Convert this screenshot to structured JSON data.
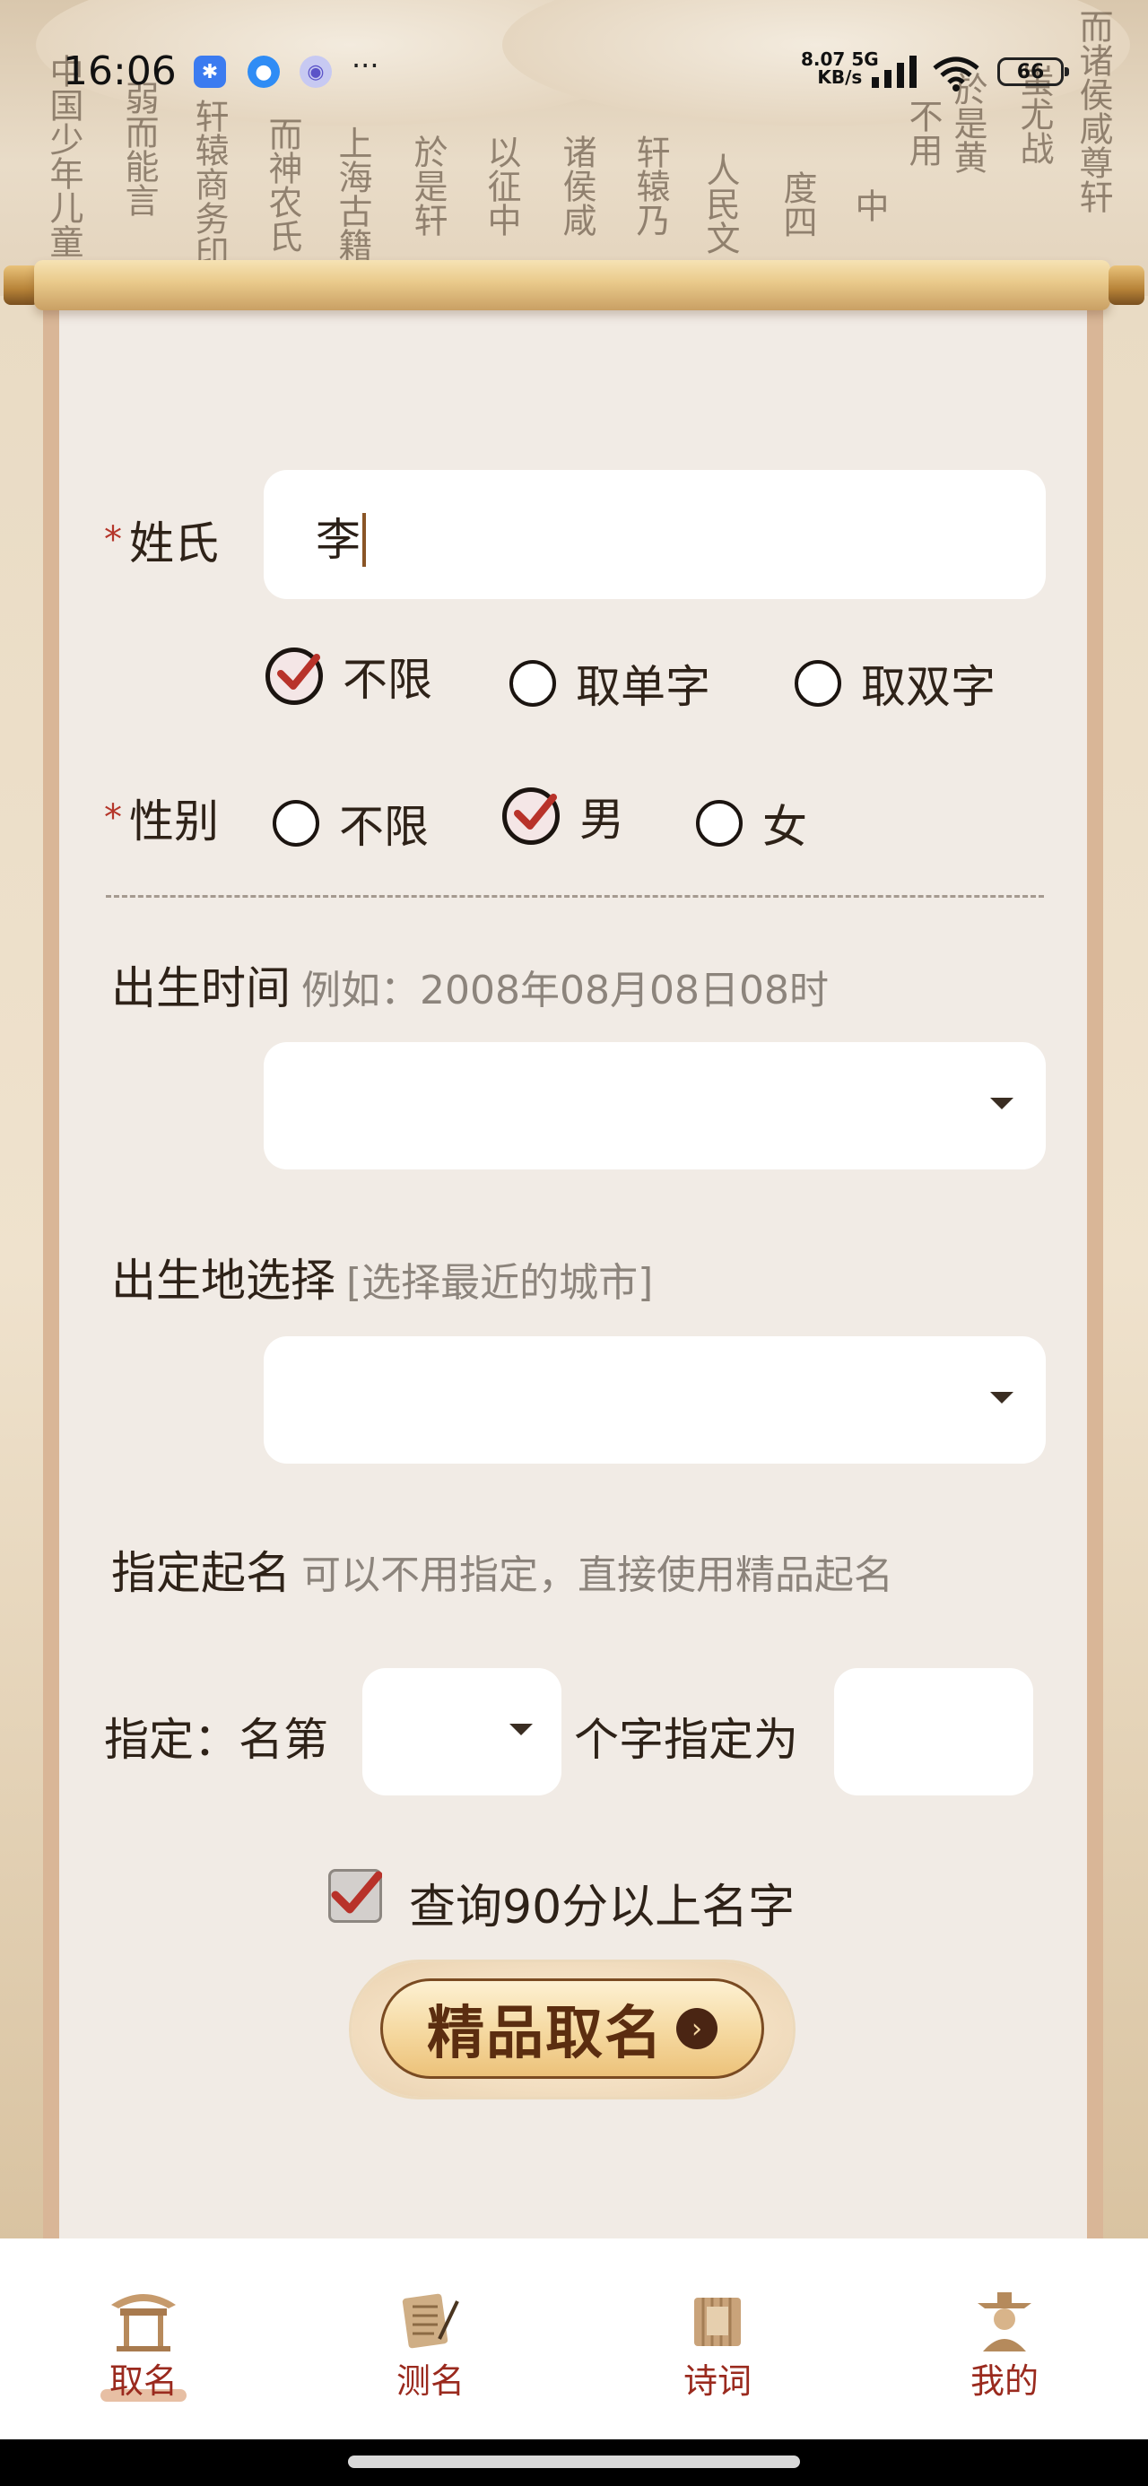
{
  "status_bar": {
    "time": "16:06",
    "network_speed": "8.07",
    "network_unit": "KB/s",
    "network_type": "5G",
    "battery": "66",
    "icons": [
      "app-notification-icon",
      "location-app-icon",
      "browser-app-icon",
      "more-dots-icon",
      "signal-icon",
      "wifi-icon",
      "battery-icon"
    ]
  },
  "form": {
    "surname": {
      "label": "姓氏",
      "required_mark": "*",
      "value": "李"
    },
    "char_count_options": [
      {
        "label": "不限",
        "checked": true
      },
      {
        "label": "取单字",
        "checked": false
      },
      {
        "label": "取双字",
        "checked": false
      }
    ],
    "gender": {
      "label": "性别",
      "required_mark": "*",
      "options": [
        {
          "label": "不限",
          "checked": false
        },
        {
          "label": "男",
          "checked": true
        },
        {
          "label": "女",
          "checked": false
        }
      ]
    },
    "birth_time": {
      "label": "出生时间",
      "hint": "例如：2008年08月08日08时",
      "value": ""
    },
    "birth_place": {
      "label": "出生地选择",
      "hint": "[选择最近的城市]",
      "value": ""
    },
    "specify": {
      "label": "指定起名",
      "hint": "可以不用指定，直接使用精品起名",
      "row_prefix": "指定：名第",
      "row_middle": "个字指定为",
      "position_value": "",
      "char_value": ""
    },
    "query_checkbox": {
      "label": "查询90分以上名字",
      "checked": true
    },
    "submit_button": "精品取名"
  },
  "bottom_nav": [
    {
      "label": "取名",
      "icon": "pavilion-icon",
      "active": true
    },
    {
      "label": "测名",
      "icon": "scroll-brush-icon",
      "active": false
    },
    {
      "label": "诗词",
      "icon": "bamboo-book-icon",
      "active": false
    },
    {
      "label": "我的",
      "icon": "scholar-avatar-icon",
      "active": false
    }
  ],
  "colors": {
    "accent": "#9a2a1e",
    "required": "#b5362a",
    "paper": "#f1ebe5",
    "button_text": "#5b2d10"
  }
}
